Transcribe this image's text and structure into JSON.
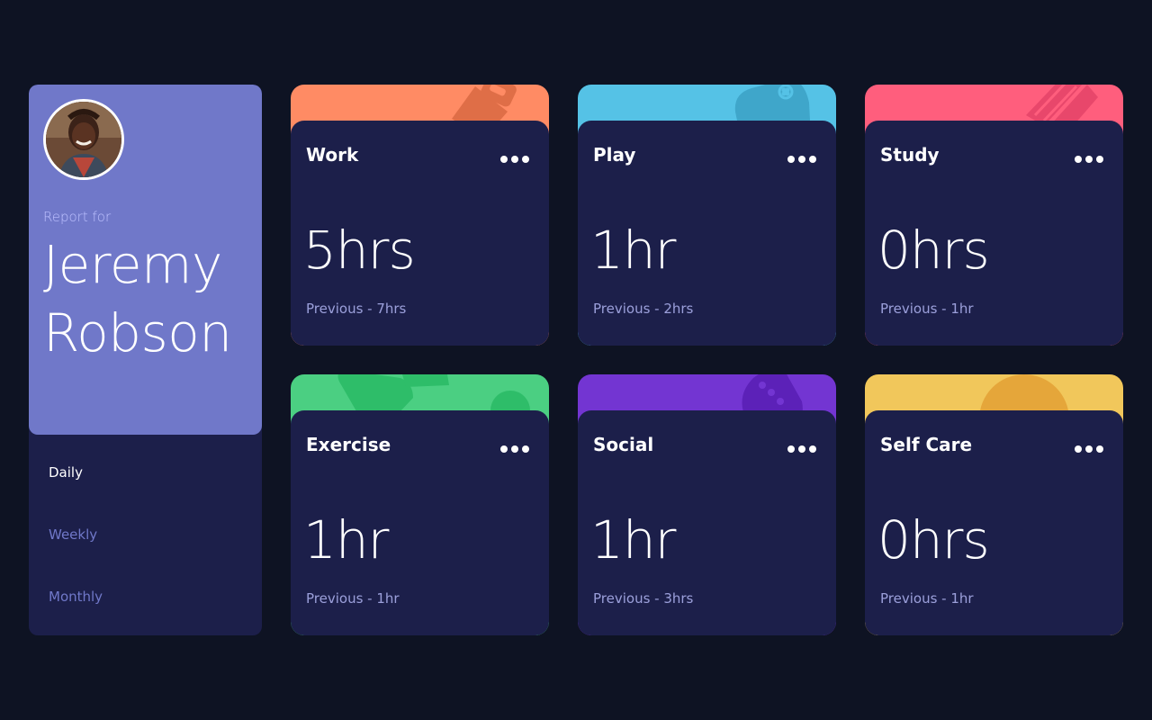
{
  "profile": {
    "report_label": "Report for",
    "first_name": "Jeremy",
    "last_name": "Robson"
  },
  "timeframes": [
    {
      "label": "Daily",
      "active": true
    },
    {
      "label": "Weekly",
      "active": false
    },
    {
      "label": "Monthly",
      "active": false
    }
  ],
  "activities": [
    {
      "title": "Work",
      "current": "5hrs",
      "previous": "Previous - 7hrs",
      "color": "#ff8b64",
      "icon": "briefcase-icon"
    },
    {
      "title": "Play",
      "current": "1hr",
      "previous": "Previous - 2hrs",
      "color": "#55c2e6",
      "icon": "gamepad-icon"
    },
    {
      "title": "Study",
      "current": "0hrs",
      "previous": "Previous - 1hr",
      "color": "#ff5e7d",
      "icon": "book-icon"
    },
    {
      "title": "Exercise",
      "current": "1hr",
      "previous": "Previous - 1hr",
      "color": "#4bcf82",
      "icon": "running-icon"
    },
    {
      "title": "Social",
      "current": "1hr",
      "previous": "Previous - 3hrs",
      "color": "#7335d2",
      "icon": "chat-icon"
    },
    {
      "title": "Self Care",
      "current": "0hrs",
      "previous": "Previous - 1hr",
      "color": "#f1c75b",
      "icon": "heart-icon"
    }
  ],
  "colors": {
    "page_bg": "#0e1323",
    "card_bg": "#1c1f4a",
    "profile_bg": "#7078c9",
    "muted_text": "#bbc0ff"
  }
}
